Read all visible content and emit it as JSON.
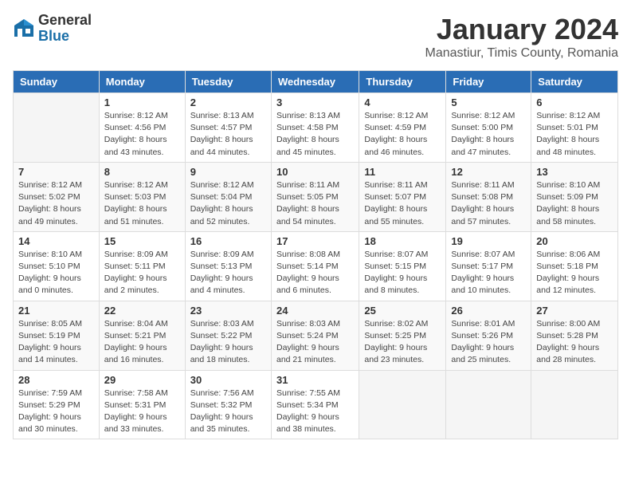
{
  "logo": {
    "general": "General",
    "blue": "Blue"
  },
  "title": "January 2024",
  "subtitle": "Manastiur, Timis County, Romania",
  "headers": [
    "Sunday",
    "Monday",
    "Tuesday",
    "Wednesday",
    "Thursday",
    "Friday",
    "Saturday"
  ],
  "weeks": [
    [
      {
        "day": "",
        "sunrise": "",
        "sunset": "",
        "daylight": ""
      },
      {
        "day": "1",
        "sunrise": "Sunrise: 8:12 AM",
        "sunset": "Sunset: 4:56 PM",
        "daylight": "Daylight: 8 hours and 43 minutes."
      },
      {
        "day": "2",
        "sunrise": "Sunrise: 8:13 AM",
        "sunset": "Sunset: 4:57 PM",
        "daylight": "Daylight: 8 hours and 44 minutes."
      },
      {
        "day": "3",
        "sunrise": "Sunrise: 8:13 AM",
        "sunset": "Sunset: 4:58 PM",
        "daylight": "Daylight: 8 hours and 45 minutes."
      },
      {
        "day": "4",
        "sunrise": "Sunrise: 8:12 AM",
        "sunset": "Sunset: 4:59 PM",
        "daylight": "Daylight: 8 hours and 46 minutes."
      },
      {
        "day": "5",
        "sunrise": "Sunrise: 8:12 AM",
        "sunset": "Sunset: 5:00 PM",
        "daylight": "Daylight: 8 hours and 47 minutes."
      },
      {
        "day": "6",
        "sunrise": "Sunrise: 8:12 AM",
        "sunset": "Sunset: 5:01 PM",
        "daylight": "Daylight: 8 hours and 48 minutes."
      }
    ],
    [
      {
        "day": "7",
        "sunrise": "Sunrise: 8:12 AM",
        "sunset": "Sunset: 5:02 PM",
        "daylight": "Daylight: 8 hours and 49 minutes."
      },
      {
        "day": "8",
        "sunrise": "Sunrise: 8:12 AM",
        "sunset": "Sunset: 5:03 PM",
        "daylight": "Daylight: 8 hours and 51 minutes."
      },
      {
        "day": "9",
        "sunrise": "Sunrise: 8:12 AM",
        "sunset": "Sunset: 5:04 PM",
        "daylight": "Daylight: 8 hours and 52 minutes."
      },
      {
        "day": "10",
        "sunrise": "Sunrise: 8:11 AM",
        "sunset": "Sunset: 5:05 PM",
        "daylight": "Daylight: 8 hours and 54 minutes."
      },
      {
        "day": "11",
        "sunrise": "Sunrise: 8:11 AM",
        "sunset": "Sunset: 5:07 PM",
        "daylight": "Daylight: 8 hours and 55 minutes."
      },
      {
        "day": "12",
        "sunrise": "Sunrise: 8:11 AM",
        "sunset": "Sunset: 5:08 PM",
        "daylight": "Daylight: 8 hours and 57 minutes."
      },
      {
        "day": "13",
        "sunrise": "Sunrise: 8:10 AM",
        "sunset": "Sunset: 5:09 PM",
        "daylight": "Daylight: 8 hours and 58 minutes."
      }
    ],
    [
      {
        "day": "14",
        "sunrise": "Sunrise: 8:10 AM",
        "sunset": "Sunset: 5:10 PM",
        "daylight": "Daylight: 9 hours and 0 minutes."
      },
      {
        "day": "15",
        "sunrise": "Sunrise: 8:09 AM",
        "sunset": "Sunset: 5:11 PM",
        "daylight": "Daylight: 9 hours and 2 minutes."
      },
      {
        "day": "16",
        "sunrise": "Sunrise: 8:09 AM",
        "sunset": "Sunset: 5:13 PM",
        "daylight": "Daylight: 9 hours and 4 minutes."
      },
      {
        "day": "17",
        "sunrise": "Sunrise: 8:08 AM",
        "sunset": "Sunset: 5:14 PM",
        "daylight": "Daylight: 9 hours and 6 minutes."
      },
      {
        "day": "18",
        "sunrise": "Sunrise: 8:07 AM",
        "sunset": "Sunset: 5:15 PM",
        "daylight": "Daylight: 9 hours and 8 minutes."
      },
      {
        "day": "19",
        "sunrise": "Sunrise: 8:07 AM",
        "sunset": "Sunset: 5:17 PM",
        "daylight": "Daylight: 9 hours and 10 minutes."
      },
      {
        "day": "20",
        "sunrise": "Sunrise: 8:06 AM",
        "sunset": "Sunset: 5:18 PM",
        "daylight": "Daylight: 9 hours and 12 minutes."
      }
    ],
    [
      {
        "day": "21",
        "sunrise": "Sunrise: 8:05 AM",
        "sunset": "Sunset: 5:19 PM",
        "daylight": "Daylight: 9 hours and 14 minutes."
      },
      {
        "day": "22",
        "sunrise": "Sunrise: 8:04 AM",
        "sunset": "Sunset: 5:21 PM",
        "daylight": "Daylight: 9 hours and 16 minutes."
      },
      {
        "day": "23",
        "sunrise": "Sunrise: 8:03 AM",
        "sunset": "Sunset: 5:22 PM",
        "daylight": "Daylight: 9 hours and 18 minutes."
      },
      {
        "day": "24",
        "sunrise": "Sunrise: 8:03 AM",
        "sunset": "Sunset: 5:24 PM",
        "daylight": "Daylight: 9 hours and 21 minutes."
      },
      {
        "day": "25",
        "sunrise": "Sunrise: 8:02 AM",
        "sunset": "Sunset: 5:25 PM",
        "daylight": "Daylight: 9 hours and 23 minutes."
      },
      {
        "day": "26",
        "sunrise": "Sunrise: 8:01 AM",
        "sunset": "Sunset: 5:26 PM",
        "daylight": "Daylight: 9 hours and 25 minutes."
      },
      {
        "day": "27",
        "sunrise": "Sunrise: 8:00 AM",
        "sunset": "Sunset: 5:28 PM",
        "daylight": "Daylight: 9 hours and 28 minutes."
      }
    ],
    [
      {
        "day": "28",
        "sunrise": "Sunrise: 7:59 AM",
        "sunset": "Sunset: 5:29 PM",
        "daylight": "Daylight: 9 hours and 30 minutes."
      },
      {
        "day": "29",
        "sunrise": "Sunrise: 7:58 AM",
        "sunset": "Sunset: 5:31 PM",
        "daylight": "Daylight: 9 hours and 33 minutes."
      },
      {
        "day": "30",
        "sunrise": "Sunrise: 7:56 AM",
        "sunset": "Sunset: 5:32 PM",
        "daylight": "Daylight: 9 hours and 35 minutes."
      },
      {
        "day": "31",
        "sunrise": "Sunrise: 7:55 AM",
        "sunset": "Sunset: 5:34 PM",
        "daylight": "Daylight: 9 hours and 38 minutes."
      },
      {
        "day": "",
        "sunrise": "",
        "sunset": "",
        "daylight": ""
      },
      {
        "day": "",
        "sunrise": "",
        "sunset": "",
        "daylight": ""
      },
      {
        "day": "",
        "sunrise": "",
        "sunset": "",
        "daylight": ""
      }
    ]
  ]
}
